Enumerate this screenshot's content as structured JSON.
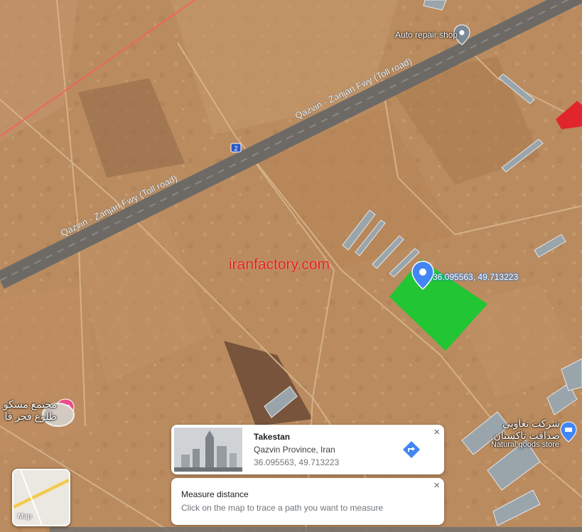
{
  "map": {
    "roads": {
      "freeway_label": "Qazvin - Zanjan Fwy (Toll road)",
      "route_number": "2"
    },
    "pois": {
      "auto_repair": "Auto repair shop"
    },
    "watermark": "iranfactory.com",
    "pin_coordinates": "36.095563, 49.713223",
    "place_left_line1": "مجتمع مسکو",
    "place_left_line2": "طلوع فجر قا",
    "place_right_line1": "شرکت تعاونی",
    "place_right_line2": "صداقت تاکستان",
    "place_right_category": "Natural goods store",
    "colors": {
      "field": "#b88a5e",
      "highlight": "#22c533",
      "pin": "#4285f4",
      "red_pin": "#ea4c89"
    }
  },
  "info_card": {
    "title": "Takestan",
    "subtitle": "Qazvin Province, Iran",
    "coordinates": "36.095563, 49.713223",
    "close_icon": "×"
  },
  "measure_card": {
    "title": "Measure distance",
    "instruction": "Click on the map to trace a path you want to measure",
    "close_icon": "×"
  },
  "map_toggle": {
    "label": "Map"
  }
}
